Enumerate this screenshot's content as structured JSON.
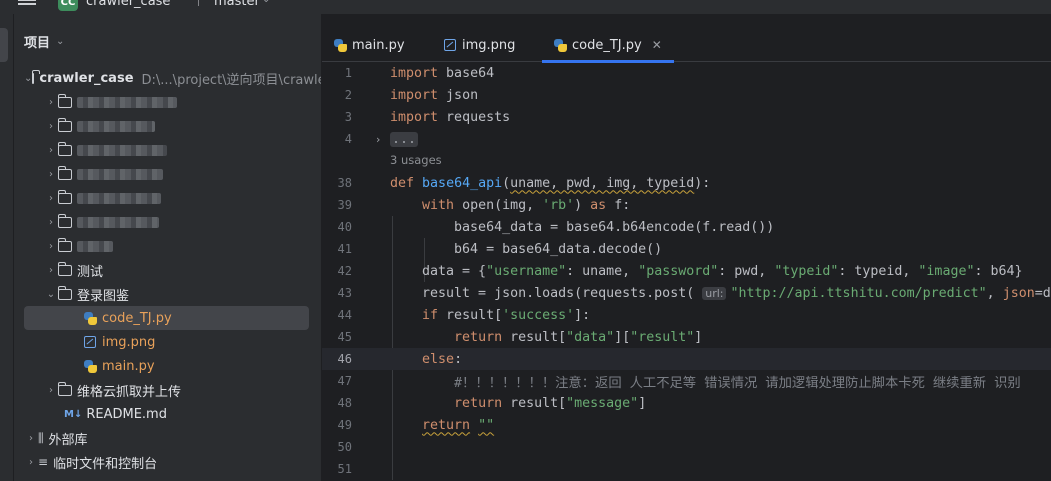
{
  "titlebar": {
    "project_badge": "CC",
    "project_name": "crawler_case",
    "branch_name": "master"
  },
  "project_panel": {
    "title": "项目",
    "root_name": "crawler_case",
    "root_path": "D:\\...\\project\\逆向项目\\crawler",
    "items": [
      {
        "label": "测试"
      },
      {
        "label": "登录图鉴"
      },
      {
        "label": "code_TJ.py"
      },
      {
        "label": "img.png"
      },
      {
        "label": "main.py"
      },
      {
        "label": "维格云抓取并上传"
      },
      {
        "label": "README.md"
      },
      {
        "label": "外部库"
      },
      {
        "label": "临时文件和控制台"
      }
    ],
    "md_badge": "M↓"
  },
  "tabs": [
    {
      "label": "main.py"
    },
    {
      "label": "img.png"
    },
    {
      "label": "code_TJ.py"
    }
  ],
  "editor": {
    "usages": "3 usages",
    "param_hint": "url:",
    "line_numbers": [
      "1",
      "2",
      "3",
      "4",
      "38",
      "39",
      "40",
      "41",
      "42",
      "43",
      "44",
      "45",
      "46",
      "47",
      "48",
      "49",
      "50",
      "51"
    ]
  },
  "colors": {
    "accent": "#3574f0",
    "keyword": "#cf8e6d",
    "string": "#6aab73",
    "function": "#56a8f5"
  }
}
